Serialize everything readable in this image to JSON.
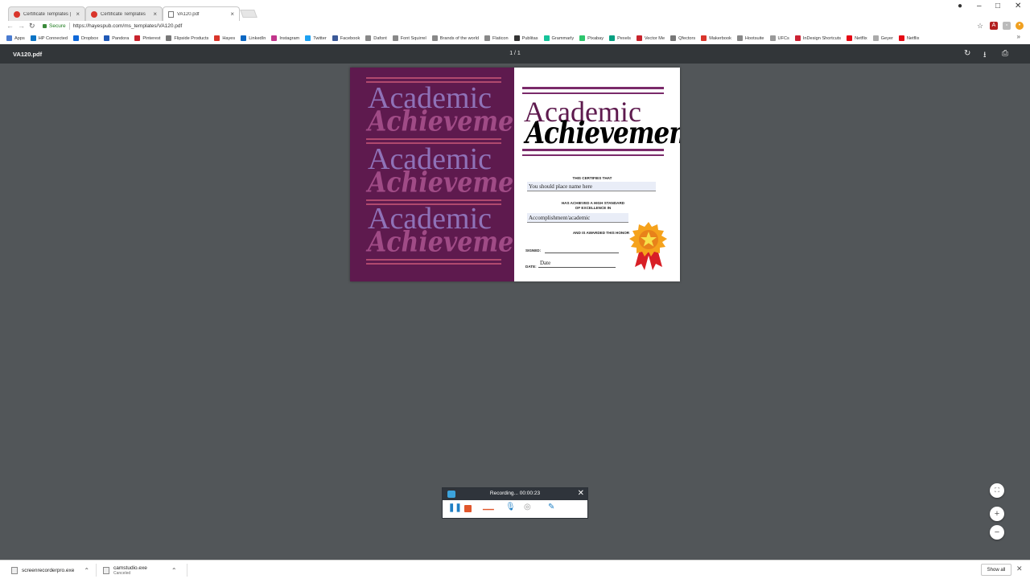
{
  "tabs": [
    {
      "label": "Certificate Templates | P",
      "icon": "certificate-red-icon"
    },
    {
      "label": "Certificate Templates",
      "icon": "certificate-red-icon"
    },
    {
      "label": "VA120.pdf",
      "icon": "document-icon"
    }
  ],
  "address": {
    "secure_label": "Secure",
    "url": "https://hayespub.com/ms_templates/VA120.pdf"
  },
  "bookmarks": [
    {
      "label": "Apps",
      "color": "#4a7bd0"
    },
    {
      "label": "HP Connected",
      "color": "#0b73c4"
    },
    {
      "label": "Dropbox",
      "color": "#0f68d8"
    },
    {
      "label": "Pandora",
      "color": "#2059b6"
    },
    {
      "label": "Pinterest",
      "color": "#c8232c"
    },
    {
      "label": "Flipside Products",
      "color": "#777777"
    },
    {
      "label": "Hayes",
      "color": "#d9352b"
    },
    {
      "label": "LinkedIn",
      "color": "#0a66c2"
    },
    {
      "label": "Instagram",
      "color": "#c1358b"
    },
    {
      "label": "Twitter",
      "color": "#1da1f2"
    },
    {
      "label": "Facebook",
      "color": "#3b5998"
    },
    {
      "label": "Dafont",
      "color": "#888888"
    },
    {
      "label": "Font Squirrel",
      "color": "#888888"
    },
    {
      "label": "Brands of the world",
      "color": "#888888"
    },
    {
      "label": "Flaticon",
      "color": "#888888"
    },
    {
      "label": "Publitas",
      "color": "#333333"
    },
    {
      "label": "Grammarly",
      "color": "#15c39a"
    },
    {
      "label": "Pixabay",
      "color": "#2ec66d"
    },
    {
      "label": "Pexels",
      "color": "#05a081"
    },
    {
      "label": "Vector Me",
      "color": "#c8232c"
    },
    {
      "label": "Qfectors",
      "color": "#777777"
    },
    {
      "label": "Makerbook",
      "color": "#d9352b"
    },
    {
      "label": "Hootsuite",
      "color": "#888888"
    },
    {
      "label": "UFCs",
      "color": "#999999"
    },
    {
      "label": "InDesign Shortcuts",
      "color": "#cc2233"
    },
    {
      "label": "Netflix",
      "color": "#e50914"
    },
    {
      "label": "Geyer",
      "color": "#aaaaaa"
    },
    {
      "label": "Netflix",
      "color": "#e50914"
    }
  ],
  "pdf": {
    "filename": "VA120.pdf",
    "page_indicator": "1 / 1"
  },
  "certificate": {
    "word1": "Academic",
    "word2": "Achievement",
    "certifies": "THIS CERTIFIES THAT",
    "name_field": "You should place name here",
    "standard_line1": "HAS ACHIEVED A HIGH STANDARD",
    "standard_line2": "OF EXCELLENCE IN",
    "accomplishment_field": "Accomplishment/academic",
    "honor": "AND IS AWARDED THIS HONOR",
    "signed_label": "SIGNED:",
    "date_label": "DATE:",
    "date_field": "Date",
    "accent_color": "#5e1a4e"
  },
  "recorder": {
    "status": "Recording... 00:00:23"
  },
  "downloads": [
    {
      "name": "screenrecorderpro.exe",
      "status": ""
    },
    {
      "name": "camstudio.exe",
      "status": "Canceled"
    }
  ],
  "shelf": {
    "show_all": "Show all"
  }
}
